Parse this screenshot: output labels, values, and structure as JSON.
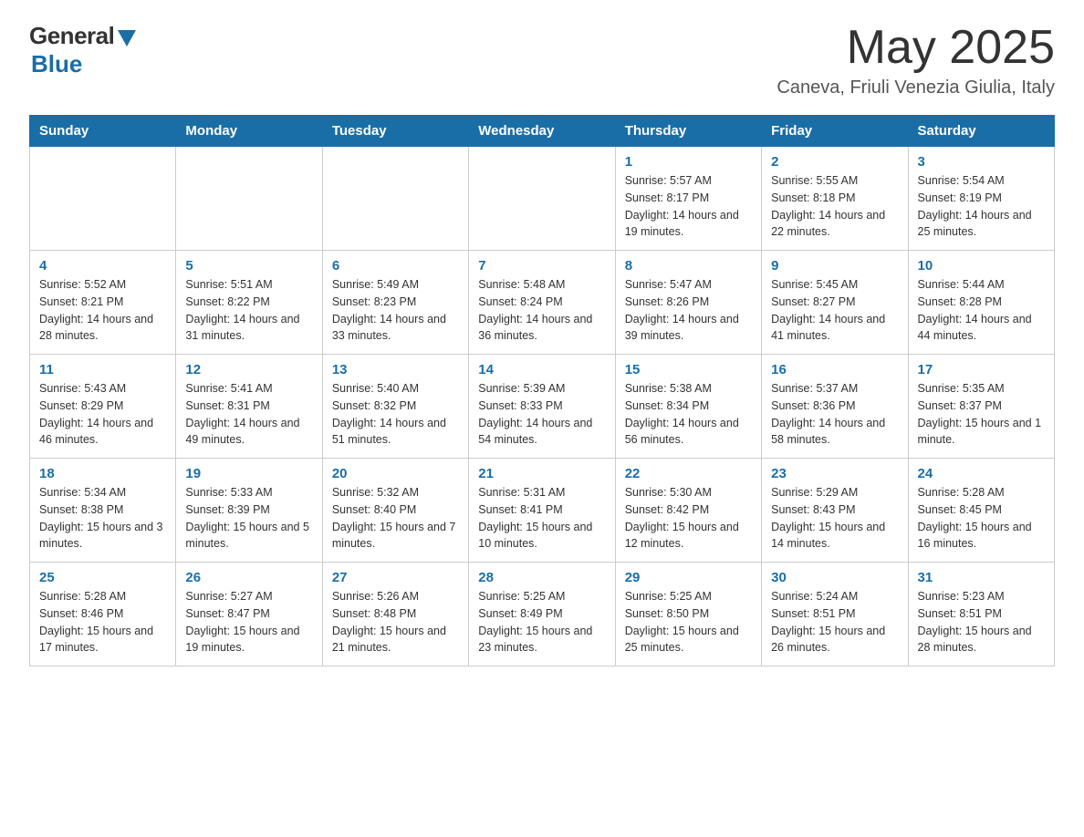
{
  "header": {
    "logo_general": "General",
    "logo_blue": "Blue",
    "month_title": "May 2025",
    "location": "Caneva, Friuli Venezia Giulia, Italy"
  },
  "days_of_week": [
    "Sunday",
    "Monday",
    "Tuesday",
    "Wednesday",
    "Thursday",
    "Friday",
    "Saturday"
  ],
  "weeks": [
    [
      {
        "day": "",
        "info": ""
      },
      {
        "day": "",
        "info": ""
      },
      {
        "day": "",
        "info": ""
      },
      {
        "day": "",
        "info": ""
      },
      {
        "day": "1",
        "info": "Sunrise: 5:57 AM\nSunset: 8:17 PM\nDaylight: 14 hours and 19 minutes."
      },
      {
        "day": "2",
        "info": "Sunrise: 5:55 AM\nSunset: 8:18 PM\nDaylight: 14 hours and 22 minutes."
      },
      {
        "day": "3",
        "info": "Sunrise: 5:54 AM\nSunset: 8:19 PM\nDaylight: 14 hours and 25 minutes."
      }
    ],
    [
      {
        "day": "4",
        "info": "Sunrise: 5:52 AM\nSunset: 8:21 PM\nDaylight: 14 hours and 28 minutes."
      },
      {
        "day": "5",
        "info": "Sunrise: 5:51 AM\nSunset: 8:22 PM\nDaylight: 14 hours and 31 minutes."
      },
      {
        "day": "6",
        "info": "Sunrise: 5:49 AM\nSunset: 8:23 PM\nDaylight: 14 hours and 33 minutes."
      },
      {
        "day": "7",
        "info": "Sunrise: 5:48 AM\nSunset: 8:24 PM\nDaylight: 14 hours and 36 minutes."
      },
      {
        "day": "8",
        "info": "Sunrise: 5:47 AM\nSunset: 8:26 PM\nDaylight: 14 hours and 39 minutes."
      },
      {
        "day": "9",
        "info": "Sunrise: 5:45 AM\nSunset: 8:27 PM\nDaylight: 14 hours and 41 minutes."
      },
      {
        "day": "10",
        "info": "Sunrise: 5:44 AM\nSunset: 8:28 PM\nDaylight: 14 hours and 44 minutes."
      }
    ],
    [
      {
        "day": "11",
        "info": "Sunrise: 5:43 AM\nSunset: 8:29 PM\nDaylight: 14 hours and 46 minutes."
      },
      {
        "day": "12",
        "info": "Sunrise: 5:41 AM\nSunset: 8:31 PM\nDaylight: 14 hours and 49 minutes."
      },
      {
        "day": "13",
        "info": "Sunrise: 5:40 AM\nSunset: 8:32 PM\nDaylight: 14 hours and 51 minutes."
      },
      {
        "day": "14",
        "info": "Sunrise: 5:39 AM\nSunset: 8:33 PM\nDaylight: 14 hours and 54 minutes."
      },
      {
        "day": "15",
        "info": "Sunrise: 5:38 AM\nSunset: 8:34 PM\nDaylight: 14 hours and 56 minutes."
      },
      {
        "day": "16",
        "info": "Sunrise: 5:37 AM\nSunset: 8:36 PM\nDaylight: 14 hours and 58 minutes."
      },
      {
        "day": "17",
        "info": "Sunrise: 5:35 AM\nSunset: 8:37 PM\nDaylight: 15 hours and 1 minute."
      }
    ],
    [
      {
        "day": "18",
        "info": "Sunrise: 5:34 AM\nSunset: 8:38 PM\nDaylight: 15 hours and 3 minutes."
      },
      {
        "day": "19",
        "info": "Sunrise: 5:33 AM\nSunset: 8:39 PM\nDaylight: 15 hours and 5 minutes."
      },
      {
        "day": "20",
        "info": "Sunrise: 5:32 AM\nSunset: 8:40 PM\nDaylight: 15 hours and 7 minutes."
      },
      {
        "day": "21",
        "info": "Sunrise: 5:31 AM\nSunset: 8:41 PM\nDaylight: 15 hours and 10 minutes."
      },
      {
        "day": "22",
        "info": "Sunrise: 5:30 AM\nSunset: 8:42 PM\nDaylight: 15 hours and 12 minutes."
      },
      {
        "day": "23",
        "info": "Sunrise: 5:29 AM\nSunset: 8:43 PM\nDaylight: 15 hours and 14 minutes."
      },
      {
        "day": "24",
        "info": "Sunrise: 5:28 AM\nSunset: 8:45 PM\nDaylight: 15 hours and 16 minutes."
      }
    ],
    [
      {
        "day": "25",
        "info": "Sunrise: 5:28 AM\nSunset: 8:46 PM\nDaylight: 15 hours and 17 minutes."
      },
      {
        "day": "26",
        "info": "Sunrise: 5:27 AM\nSunset: 8:47 PM\nDaylight: 15 hours and 19 minutes."
      },
      {
        "day": "27",
        "info": "Sunrise: 5:26 AM\nSunset: 8:48 PM\nDaylight: 15 hours and 21 minutes."
      },
      {
        "day": "28",
        "info": "Sunrise: 5:25 AM\nSunset: 8:49 PM\nDaylight: 15 hours and 23 minutes."
      },
      {
        "day": "29",
        "info": "Sunrise: 5:25 AM\nSunset: 8:50 PM\nDaylight: 15 hours and 25 minutes."
      },
      {
        "day": "30",
        "info": "Sunrise: 5:24 AM\nSunset: 8:51 PM\nDaylight: 15 hours and 26 minutes."
      },
      {
        "day": "31",
        "info": "Sunrise: 5:23 AM\nSunset: 8:51 PM\nDaylight: 15 hours and 28 minutes."
      }
    ]
  ]
}
